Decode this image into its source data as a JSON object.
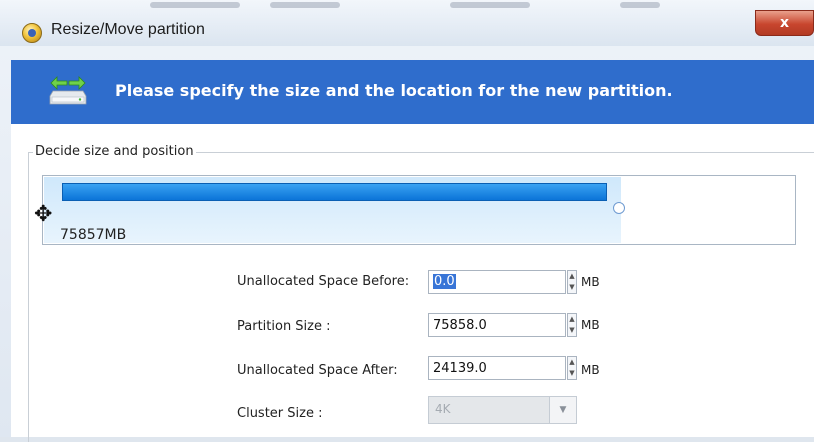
{
  "window": {
    "title": "Resize/Move partition",
    "close_label": "x"
  },
  "banner": {
    "text": "Please specify the size and the location for the new partition."
  },
  "group": {
    "label": "Decide size and position"
  },
  "partition_bar": {
    "size_label": "75857MB",
    "used_fraction": 0.7586
  },
  "form": {
    "before_label": "Unallocated Space Before:",
    "before_value": "0.0",
    "size_label": "Partition Size :",
    "size_value": "75858.0",
    "after_label": "Unallocated Space After:",
    "after_value": "24139.0",
    "cluster_label": "Cluster Size :",
    "cluster_value": "4K",
    "unit": "MB"
  },
  "colors": {
    "banner": "#2f6dcc",
    "bar_fill": "#0b74d8",
    "close": "#c8462e"
  }
}
